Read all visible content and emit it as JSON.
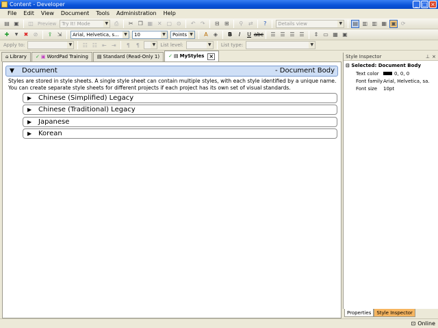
{
  "window": {
    "title": "Content - Developer"
  },
  "menu": [
    "File",
    "Edit",
    "View",
    "Document",
    "Tools",
    "Administration",
    "Help"
  ],
  "toolbar1": {
    "preview_label": "Preview",
    "mode_value": "Try It! Mode",
    "view_value": "Details view"
  },
  "toolbar2": {
    "font_value": "Arial, Helvetica, s...",
    "size_value": "10",
    "unit_value": "Points"
  },
  "toolbar3": {
    "apply_to_label": "Apply to:",
    "list_level_label": "List level:",
    "list_type_label": "List type:"
  },
  "tabs": [
    {
      "label": "Library"
    },
    {
      "label": "WordPad Training"
    },
    {
      "label": "Standard (Read-Only 1)"
    },
    {
      "label": "MyStyles"
    }
  ],
  "document": {
    "heading": "Document",
    "heading_right": "- Document Body",
    "description": "Styles are stored in style sheets. A single style sheet can contain multiple styles, with each style identified by a unique name. You can create separate style sheets for different projects if each project has its own set of visual standards.",
    "sections": [
      "Chinese (Simplified) Legacy",
      "Chinese (Traditional) Legacy",
      "Japanese",
      "Korean"
    ]
  },
  "inspector": {
    "title": "Style Inspector",
    "selected": "Selected: Document Body",
    "props": [
      {
        "name": "Text color",
        "value": "0, 0, 0"
      },
      {
        "name": "Font family",
        "value": "Arial, Helvetica, sa..."
      },
      {
        "name": "Font size",
        "value": "10pt"
      }
    ],
    "tabs": [
      "Properties",
      "Style Inspector"
    ]
  },
  "status": {
    "online": "Online"
  },
  "colors": {
    "title_bar": "#0a52d8",
    "doc_header": "#cfdff6",
    "active_panel_tab": "#f6b560"
  }
}
